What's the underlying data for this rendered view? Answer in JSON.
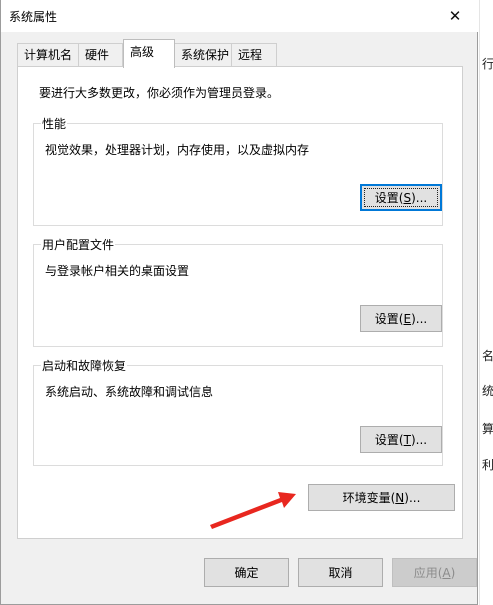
{
  "window": {
    "title": "系统属性"
  },
  "tabs": [
    {
      "label": "计算机名",
      "active": false
    },
    {
      "label": "硬件",
      "active": false
    },
    {
      "label": "高级",
      "active": true
    },
    {
      "label": "系统保护",
      "active": false
    },
    {
      "label": "远程",
      "active": false
    }
  ],
  "intro_text": "要进行大多数更改，你必须作为管理员登录。",
  "groups": {
    "performance": {
      "title": "性能",
      "description": "视觉效果，处理器计划，内存使用，以及虚拟内存",
      "button": {
        "prefix": "设置(",
        "key": "S",
        "suffix": ")..."
      }
    },
    "user_profiles": {
      "title": "用户配置文件",
      "description": "与登录帐户相关的桌面设置",
      "button": {
        "prefix": "设置(",
        "key": "E",
        "suffix": ")..."
      }
    },
    "startup_recovery": {
      "title": "启动和故障恢复",
      "description": "系统启动、系统故障和调试信息",
      "button": {
        "prefix": "设置(",
        "key": "T",
        "suffix": ")..."
      }
    }
  },
  "env_button": {
    "prefix": "环境变量(",
    "key": "N",
    "suffix": ")..."
  },
  "footer": {
    "ok": "确定",
    "cancel": "取消",
    "apply": {
      "prefix": "应用(",
      "key": "A",
      "suffix": ")"
    }
  },
  "background_fragments": [
    "行",
    "名",
    "统",
    "算",
    "利"
  ],
  "colors": {
    "arrow": "#e8271f",
    "focus": "#0078d7"
  }
}
